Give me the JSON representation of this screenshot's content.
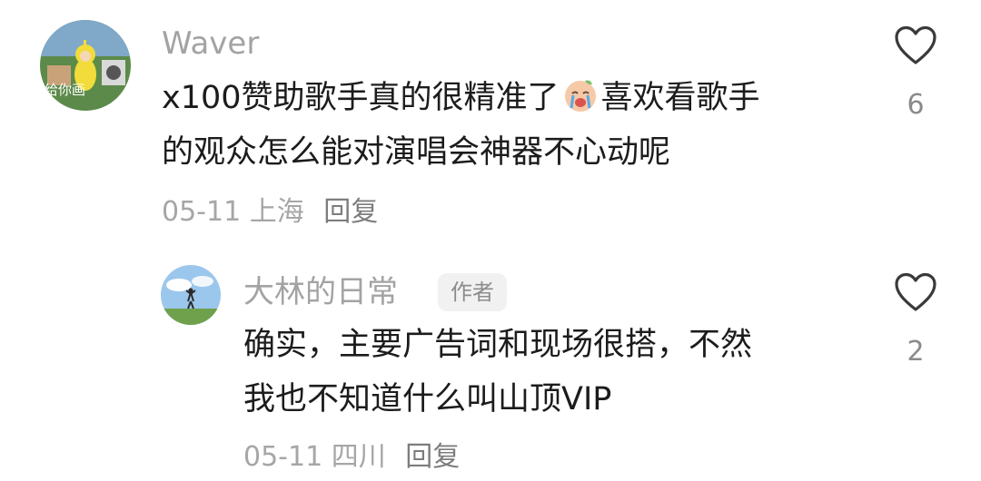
{
  "comments": [
    {
      "username": "Waver",
      "avatar_caption": "给你画",
      "text_lines": [
        "x100赞助歌手真的很精准了",
        "喜欢看歌手",
        "的观众怎么能对演唱会神器不心动呢"
      ],
      "emoji_icon": "crying-face-emoji",
      "date": "05-11",
      "location": "上海",
      "reply_label": "回复",
      "like_count": "6"
    }
  ],
  "replies": [
    {
      "username": "大林的日常",
      "badge": "作者",
      "text_lines": [
        "确实，主要广告词和现场很搭，不然",
        "我也不知道什么叫山顶VIP"
      ],
      "date": "05-11",
      "location": "四川",
      "reply_label": "回复",
      "like_count": "2"
    }
  ],
  "icons": {
    "like": "heart-outline-icon"
  },
  "colors": {
    "username": "#a3a3a3",
    "meta": "#a6a6a6",
    "body": "#1c1c1c",
    "badge_bg": "#f1f1f1"
  }
}
